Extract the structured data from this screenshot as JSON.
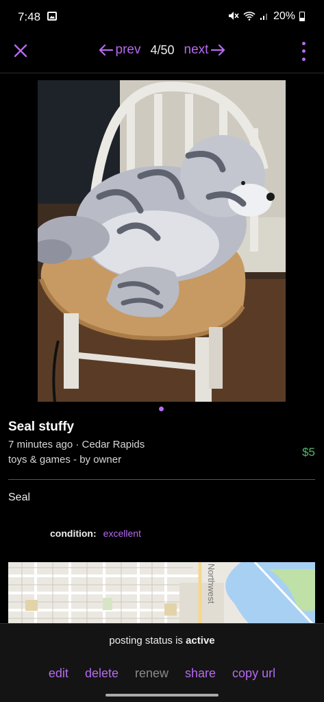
{
  "status_bar": {
    "time": "7:48",
    "battery": "20%",
    "icons": [
      "gallery-icon",
      "mute-icon",
      "wifi-icon",
      "signal-icon",
      "battery-icon"
    ]
  },
  "nav": {
    "close_icon": "close-icon",
    "prev_label": "prev",
    "next_label": "next",
    "counter": "4/50",
    "more_icon": "more-vertical-icon"
  },
  "listing": {
    "title": "Seal stuffy",
    "meta": "7 minutes ago · Cedar Rapids",
    "category": "toys & games - by owner",
    "price": "$5",
    "body": "Seal",
    "attributes": [
      {
        "key": "condition:",
        "value": "excellent"
      }
    ],
    "photo_index": 1,
    "map_street_label": "Northwest"
  },
  "bottom": {
    "status_prefix": "posting status is ",
    "status_value": "active",
    "actions": [
      {
        "label": "edit",
        "enabled": true
      },
      {
        "label": "delete",
        "enabled": true
      },
      {
        "label": "renew",
        "enabled": false
      },
      {
        "label": "share",
        "enabled": true
      },
      {
        "label": "copy url",
        "enabled": true
      }
    ]
  },
  "colors": {
    "accent": "#b76af0",
    "price": "#54b86b",
    "background": "#000000"
  }
}
